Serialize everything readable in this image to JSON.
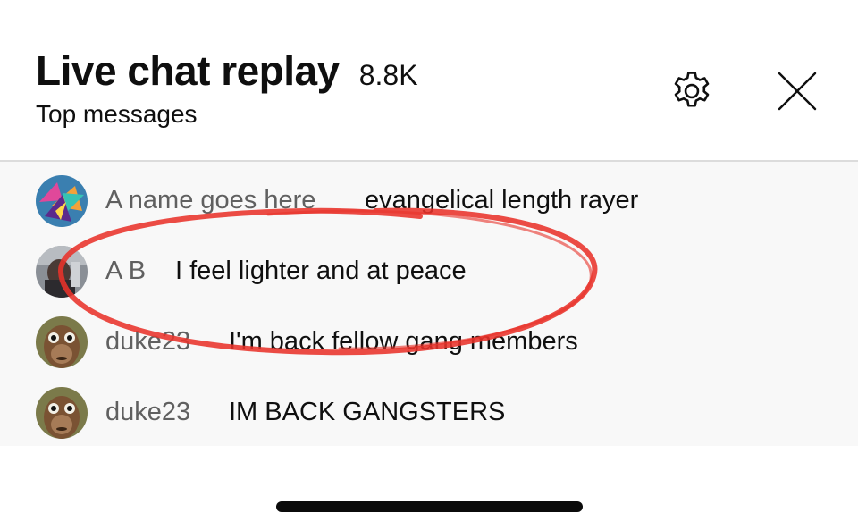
{
  "header": {
    "title": "Live chat replay",
    "count": "8.8K",
    "subtitle": "Top messages",
    "settings_icon": "gear-icon",
    "close_icon": "close-icon"
  },
  "messages": [
    {
      "author": "A name goes here",
      "text": "evangelical length rayer",
      "avatar": "colorful-abstract-avatar"
    },
    {
      "author": "A B",
      "text": "I feel lighter and at peace",
      "avatar": "photo-avatar"
    },
    {
      "author": "duke23",
      "text": "I'm back fellow gang members",
      "avatar": "monkey-face-avatar"
    },
    {
      "author": "duke23",
      "text": "IM BACK GANGSTERS",
      "avatar": "monkey-face-avatar"
    }
  ],
  "colors": {
    "author_text": "#606060",
    "message_text": "#0f0f0f",
    "list_background": "#f8f8f8",
    "annotation_red": "#e8322a"
  }
}
